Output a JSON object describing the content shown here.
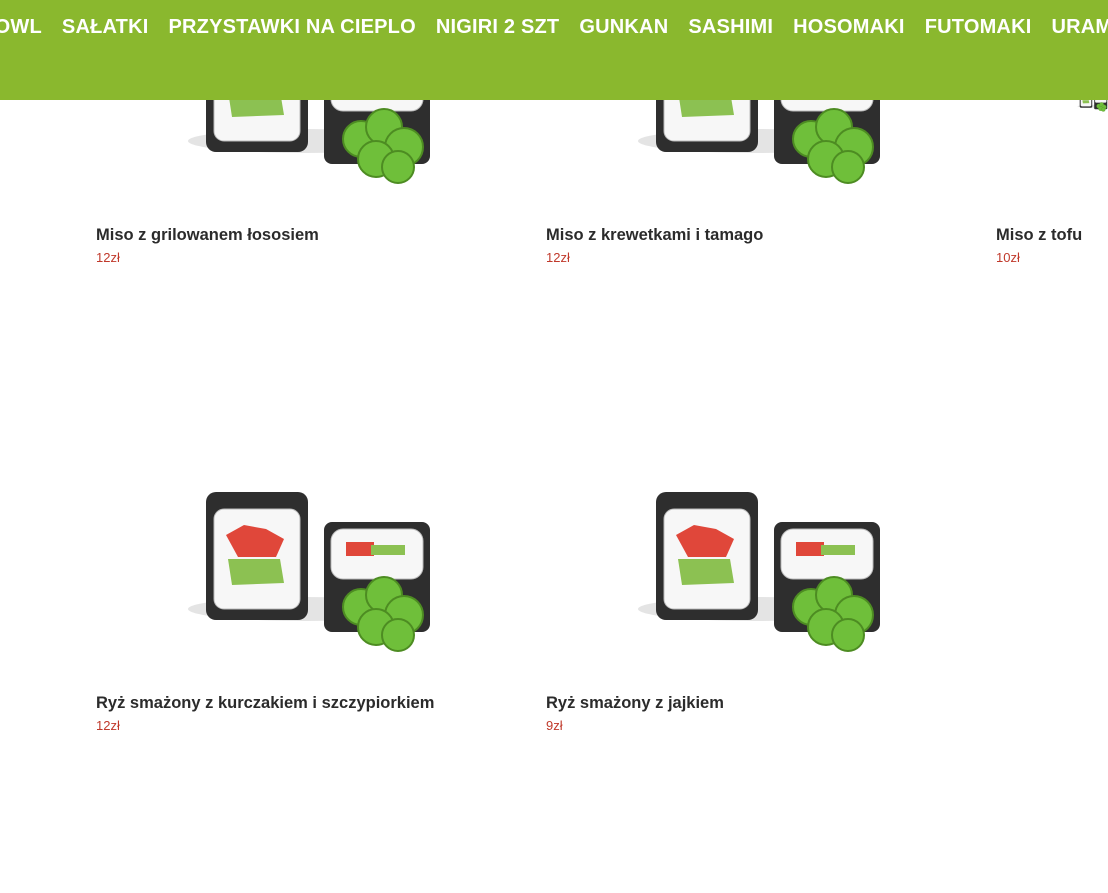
{
  "nav": {
    "items": [
      "BOWL",
      "SAŁATKI",
      "PRZYSTAWKI NA CIEPLO",
      "NIGIRI 2 SZT",
      "GUNKAN",
      "SASHIMI",
      "HOSOMAKI",
      "FUTOMAKI",
      "URAMAKI"
    ]
  },
  "products": [
    {
      "title": "Miso z grilowanem łososiem",
      "price": "12zł"
    },
    {
      "title": "Miso z krewetkami i tamago",
      "price": "12zł"
    },
    {
      "title": "Miso z tofu",
      "price": "10zł"
    },
    {
      "title": "Ryż smażony z kurczakiem i szczypiorkiem",
      "price": "12zł"
    },
    {
      "title": "Ryż smażony z jajkiem",
      "price": "9zł"
    }
  ],
  "colors": {
    "nav_bg": "#8ab82e",
    "price": "#c0392b",
    "title": "#2b2b2b"
  },
  "icons": {
    "product_image": "sushi-roll-illustration"
  }
}
